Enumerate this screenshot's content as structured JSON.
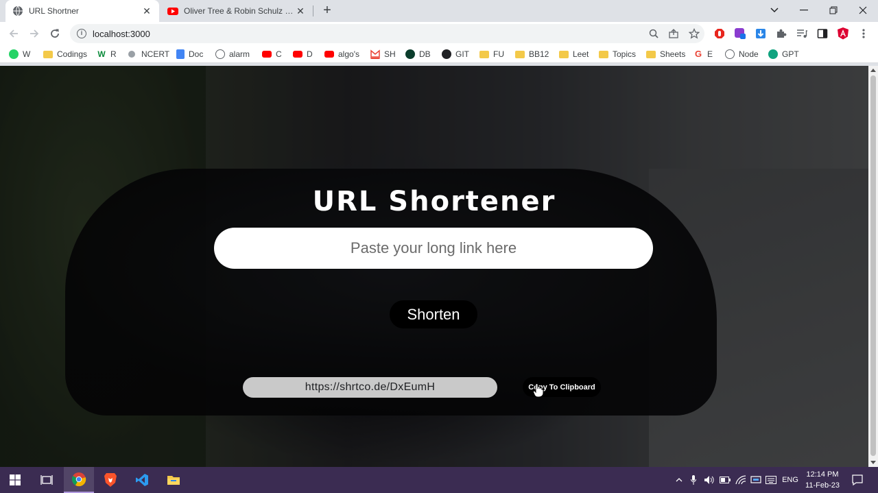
{
  "browser": {
    "tabs": [
      {
        "title": "URL Shortner",
        "favicon": "globe-icon",
        "active": true
      },
      {
        "title": "Oliver Tree & Robin Schulz - Miss You",
        "favicon": "youtube-icon",
        "active": false
      }
    ],
    "new_tab_symbol": "+",
    "window_controls": {
      "dropdown": "⌄",
      "minimize": "—",
      "maximize": "❐",
      "close": "✕"
    },
    "address": "localhost:3000",
    "bookmarks": [
      {
        "label": "W",
        "icon": "whatsapp-icon",
        "color": "#25d366"
      },
      {
        "label": "Codings",
        "icon": "folder-icon",
        "color": "#f3c949"
      },
      {
        "label": "R",
        "icon": "w-logo-icon",
        "color": "#0a8a3a"
      },
      {
        "label": "NCERT",
        "icon": "globe-icon",
        "color": "#888888"
      },
      {
        "label": "Doc",
        "icon": "docs-icon",
        "color": "#4285f4"
      },
      {
        "label": "alarm",
        "icon": "alarm-icon",
        "color": "#5f6368"
      },
      {
        "label": "C",
        "icon": "youtube-icon",
        "color": "#ff0000"
      },
      {
        "label": "D",
        "icon": "youtube-icon",
        "color": "#ff0000"
      },
      {
        "label": "algo's",
        "icon": "youtube-icon",
        "color": "#ff0000"
      },
      {
        "label": "SH",
        "icon": "gmail-icon",
        "color": "#ea4335"
      },
      {
        "label": "DB",
        "icon": "mongodb-icon",
        "color": "#13aa52"
      },
      {
        "label": "GIT",
        "icon": "github-icon",
        "color": "#202124"
      },
      {
        "label": "FU",
        "icon": "folder-icon",
        "color": "#f3c949"
      },
      {
        "label": "BB12",
        "icon": "folder-icon",
        "color": "#f3c949"
      },
      {
        "label": "Leet",
        "icon": "folder-icon",
        "color": "#f3c949"
      },
      {
        "label": "Topics",
        "icon": "folder-icon",
        "color": "#f3c949"
      },
      {
        "label": "Sheets",
        "icon": "folder-icon",
        "color": "#f3c949"
      },
      {
        "label": "E",
        "icon": "google-icon",
        "color": "#ea4335"
      },
      {
        "label": "Node",
        "icon": "globe-icon",
        "color": "#888888"
      },
      {
        "label": "GPT",
        "icon": "openai-icon",
        "color": "#10a37f"
      }
    ]
  },
  "app": {
    "title": "URL Shortener",
    "input_placeholder": "Paste your long link here",
    "shorten_label": "Shorten",
    "short_url": "https://shrtco.de/DxEumH",
    "copy_label": "Copy To Clipboard"
  },
  "taskbar": {
    "language": "ENG",
    "time": "12:14 PM",
    "date": "11-Feb-23"
  }
}
